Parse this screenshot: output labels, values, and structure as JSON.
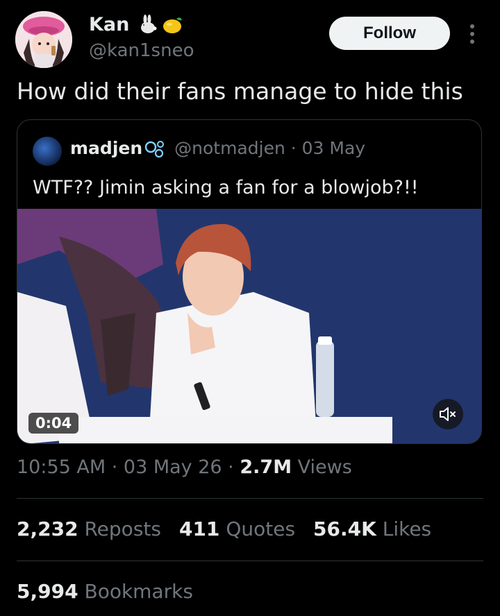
{
  "post": {
    "author": {
      "display_name": "Kan",
      "handle": "@kan1sneo",
      "emojis": [
        "rabbit-emoji",
        "lemon-emoji"
      ]
    },
    "follow_label": "Follow",
    "text": "How did their fans manage to hide this",
    "quote": {
      "display_name": "madjen",
      "badge_icon": "bubbles-emoji",
      "meta": "@notmadjen · 03 May",
      "text": "WTF?? Jimin asking a fan for a blowjob?!!",
      "video": {
        "duration": "0:04",
        "mute_icon": "muted-speaker-icon"
      }
    },
    "meta": {
      "time_date": "10:55 AM · 03 May 26 · ",
      "views_count": "2.7M",
      "views_label": " Views"
    },
    "stats": {
      "reposts_count": "2,232",
      "reposts_label": "Reposts",
      "quotes_count": "411",
      "quotes_label": "Quotes",
      "likes_count": "56.4K",
      "likes_label": "Likes",
      "bookmarks_count": "5,994",
      "bookmarks_label": "Bookmarks"
    }
  },
  "colors": {
    "background": "#000000",
    "primary_text": "#e7e9ea",
    "secondary_text": "#71767b",
    "divider": "#2f3336",
    "follow_bg": "#eff3f4"
  }
}
